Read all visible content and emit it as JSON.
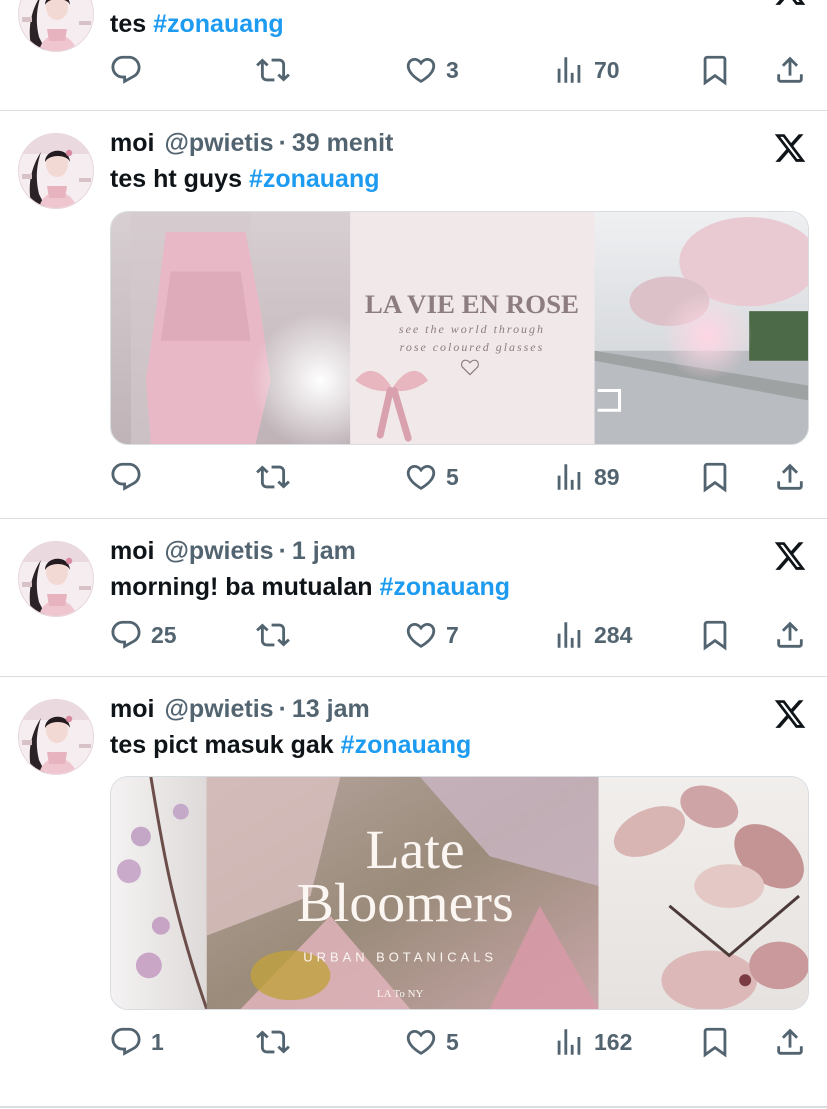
{
  "colors": {
    "accent": "#1d9bf0",
    "muted": "#536471",
    "text": "#0f1419",
    "divider": "#d8dde2"
  },
  "icons": {
    "reply": "reply-icon",
    "retweet": "retweet-icon",
    "like": "heart-icon",
    "views": "views-chart-icon",
    "bookmark": "bookmark-icon",
    "share": "share-icon",
    "brand": "x-logo-icon"
  },
  "tweets": [
    {
      "text_plain": "tes",
      "hashtag": "#zonauang",
      "stats": {
        "reply": "",
        "retweet": "",
        "like": "3",
        "views": "70"
      }
    },
    {
      "name": "moi",
      "handle": "@pwietis",
      "separator": "·",
      "time": "39 menit",
      "text_plain": "tes ht guys",
      "hashtag": "#zonauang",
      "media_text": {
        "title": "LA VIE EN ROSE",
        "line1": "see the world through",
        "line2": "rose coloured glasses"
      },
      "stats": {
        "reply": "",
        "retweet": "",
        "like": "5",
        "views": "89"
      }
    },
    {
      "name": "moi",
      "handle": "@pwietis",
      "separator": "·",
      "time": "1 jam",
      "text_plain": "morning! ba mutualan",
      "hashtag": "#zonauang",
      "stats": {
        "reply": "25",
        "retweet": "",
        "like": "7",
        "views": "284"
      }
    },
    {
      "name": "moi",
      "handle": "@pwietis",
      "separator": "·",
      "time": "13 jam",
      "text_plain": "tes pict masuk gak",
      "hashtag": "#zonauang",
      "media_text": {
        "title1": "Late",
        "title2": "Bloomers",
        "subtitle": "URBAN BOTANICALS",
        "logo": "LA To NY"
      },
      "stats": {
        "reply": "1",
        "retweet": "",
        "like": "5",
        "views": "162"
      }
    }
  ]
}
